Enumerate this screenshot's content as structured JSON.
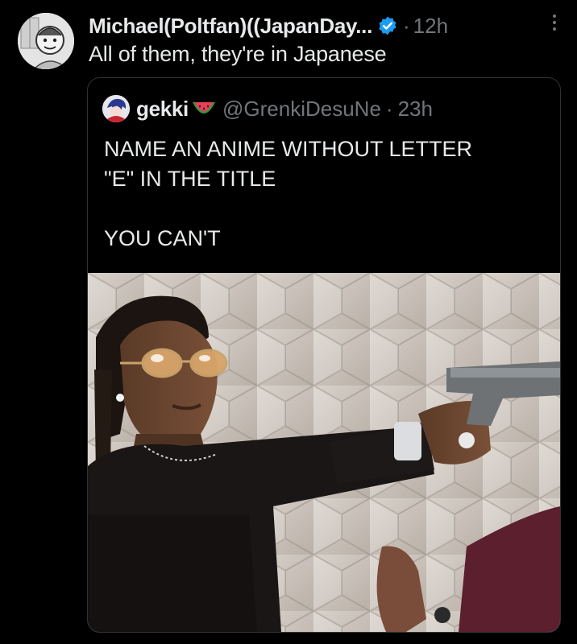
{
  "post": {
    "display_name": "Michael(Poltfan)((JapanDay...",
    "time": "12h",
    "dot": "·",
    "text": "All of them, they're in Japanese",
    "verified_icon": "verified-badge-icon",
    "more_icon": "more-options-icon"
  },
  "quoted": {
    "display_name": "gekki",
    "handle": "@GrenkiDesuNe",
    "dot": "·",
    "time": "23h",
    "emoji_icon": "watermelon-icon",
    "text": "NAME AN ANIME WITHOUT LETTER\n\"E\" IN THE TITLE\n\nYOU CAN'T",
    "media_icon": "meme-photo"
  },
  "colors": {
    "background": "#000000",
    "text": "#e7e9ea",
    "muted": "#71767b",
    "verified": "#1d9bf0",
    "border": "#2f3336"
  }
}
